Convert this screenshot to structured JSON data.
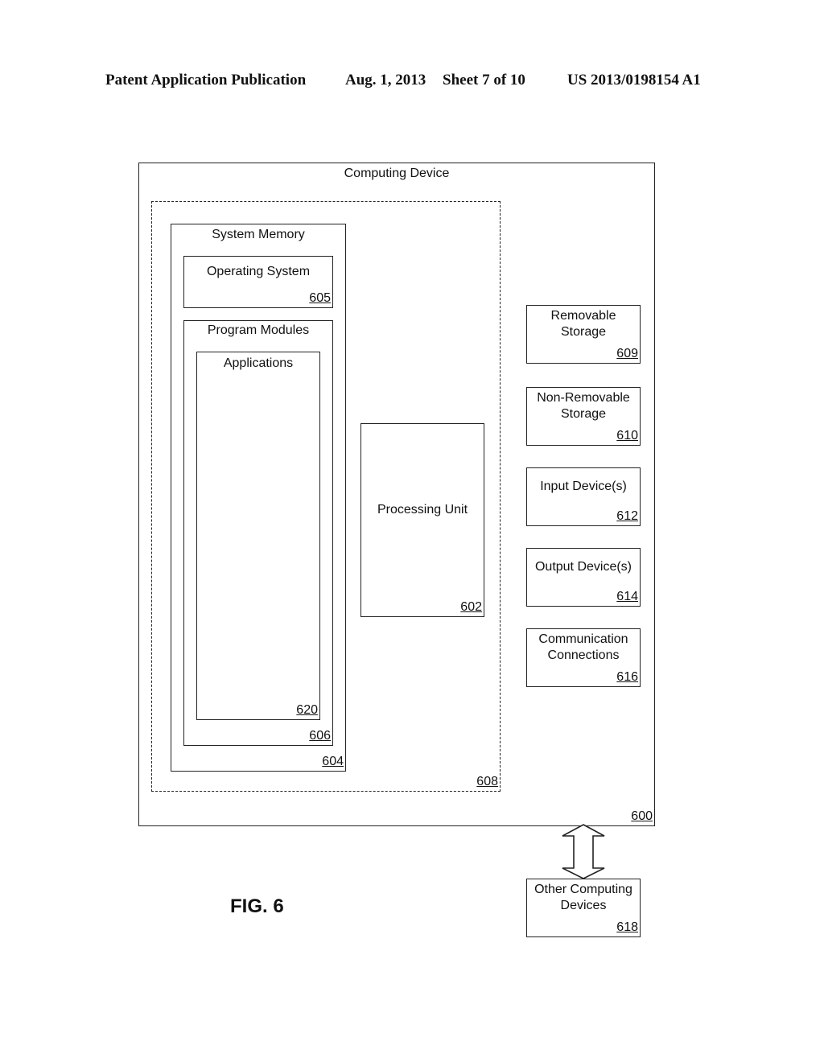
{
  "header": {
    "publication": "Patent Application Publication",
    "date": "Aug. 1, 2013",
    "sheet": "Sheet 7 of 10",
    "number": "US 2013/0198154 A1"
  },
  "diagram": {
    "computing_device": {
      "label": "Computing Device",
      "ref": "600"
    },
    "basic_config": {
      "ref": "608"
    },
    "system_memory": {
      "label": "System Memory",
      "ref": "604"
    },
    "operating_system": {
      "label": "Operating System",
      "ref": "605"
    },
    "program_modules": {
      "label": "Program Modules",
      "ref": "606"
    },
    "applications": {
      "label": "Applications",
      "ref": "620"
    },
    "processing_unit": {
      "label": "Processing Unit",
      "ref": "602"
    },
    "removable_storage": {
      "label": "Removable\nStorage",
      "ref": "609"
    },
    "non_removable_storage": {
      "label": "Non-Removable\nStorage",
      "ref": "610"
    },
    "input_devices": {
      "label": "Input Device(s)",
      "ref": "612"
    },
    "output_devices": {
      "label": "Output Device(s)",
      "ref": "614"
    },
    "communication_connections": {
      "label": "Communication\nConnections",
      "ref": "616"
    },
    "other_computing_devices": {
      "label": "Other Computing\nDevices",
      "ref": "618"
    },
    "connector": "double-arrow-icon"
  },
  "figure_label": "FIG. 6"
}
